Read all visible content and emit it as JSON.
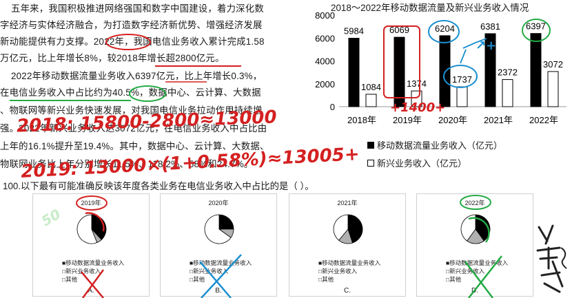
{
  "passage": {
    "lines": [
      "五年来，我国积极推进网络强国和数字中国建设，着力深化数",
      "字经济与实体经济融合，为打造数字经济新优势、增强经济发展",
      "新动能提供有力支撑。2022年，我国电信业务收入累计完成1.58",
      "万亿元，比上年增长8%，较2018年增长超2800亿元。",
      "2022年移动数据流量业务收入6397亿元，比上年增长0.3%，",
      "在电信业务收入中占比约为40.5%，数据中心、云计算、大数据",
      "、物联网等新兴业务快速发展，对我国电信业务拉动作用持续增",
      "强。2022年新兴业务收入达3072亿元，在电信业务收入中占比由",
      "上年的16.1%提升至19.4%。其中，数据中心、云计算、大数据、",
      "物联网业务比上年分别增长11.5%、118.2%、58%和24.7%。"
    ],
    "question": "100.以下最有可能准确反映该年度各类业务在电信业务收入中占比的是（ ）。"
  },
  "chart_title": "2018～2022年移动数据流量及新兴业务收入情况",
  "chart_data": [
    {
      "type": "bar",
      "title": "2018～2022年移动数据流量及新兴业务收入情况",
      "categories": [
        "2018年",
        "2019年",
        "2020年",
        "2021年",
        "2022年"
      ],
      "series": [
        {
          "name": "移动数据流量业务收入（亿元）",
          "values": [
            5984,
            6069,
            6204,
            6381,
            6397
          ],
          "color": "#000000"
        },
        {
          "name": "新兴业务收入（亿元）",
          "values": [
            1084,
            1374,
            1737,
            2372,
            3072
          ],
          "color": "#ffffff"
        }
      ],
      "y_ticks": [
        "0",
        "2000",
        "4000",
        "6000",
        "8000"
      ],
      "ylim": [
        0,
        8000
      ],
      "legend_position": "bottom"
    },
    {
      "type": "pie",
      "title": "2019年",
      "labels": [
        "移动数据流量业务收入",
        "新兴业务收入",
        "其他"
      ],
      "values": [
        38,
        6,
        56
      ]
    },
    {
      "type": "pie",
      "title": "2020年",
      "labels": [
        "移动数据流量业务收入",
        "新兴业务收入",
        "其他"
      ],
      "values": [
        25,
        10,
        65
      ]
    },
    {
      "type": "pie",
      "title": "2021年",
      "labels": [
        "移动数据流量业务收入",
        "新兴业务收入",
        "其他"
      ],
      "values": [
        45,
        16,
        39
      ]
    },
    {
      "type": "pie",
      "title": "2022年",
      "labels": [
        "移动数据流量业务收入",
        "新兴业务收入",
        "其他"
      ],
      "values": [
        40,
        20,
        40
      ]
    }
  ],
  "options": [
    {
      "year": "2019年",
      "letter": "A."
    },
    {
      "year": "2020年",
      "letter": "B."
    },
    {
      "year": "2021年",
      "letter": "C."
    },
    {
      "year": "2022年",
      "letter": "D."
    }
  ],
  "pie_legend": [
    "■移动数据流量业务收入",
    "□新兴业务收入",
    "□其他"
  ],
  "annotations": {
    "line1": "2018: 15800-2800≈13000",
    "line2": "2019: 13000×(1+0.58%)≈13005+",
    "plus": "+1400+",
    "margin": "50",
    "check": "J",
    "arrows": "↗+"
  },
  "colors": {
    "ink_black": "#000000",
    "annot_red": "#d42020",
    "annot_blue": "#1a8fd0",
    "annot_green": "#22aa44",
    "new_business_slice": "#b0b0b0",
    "other_slice": "#ffffff"
  }
}
